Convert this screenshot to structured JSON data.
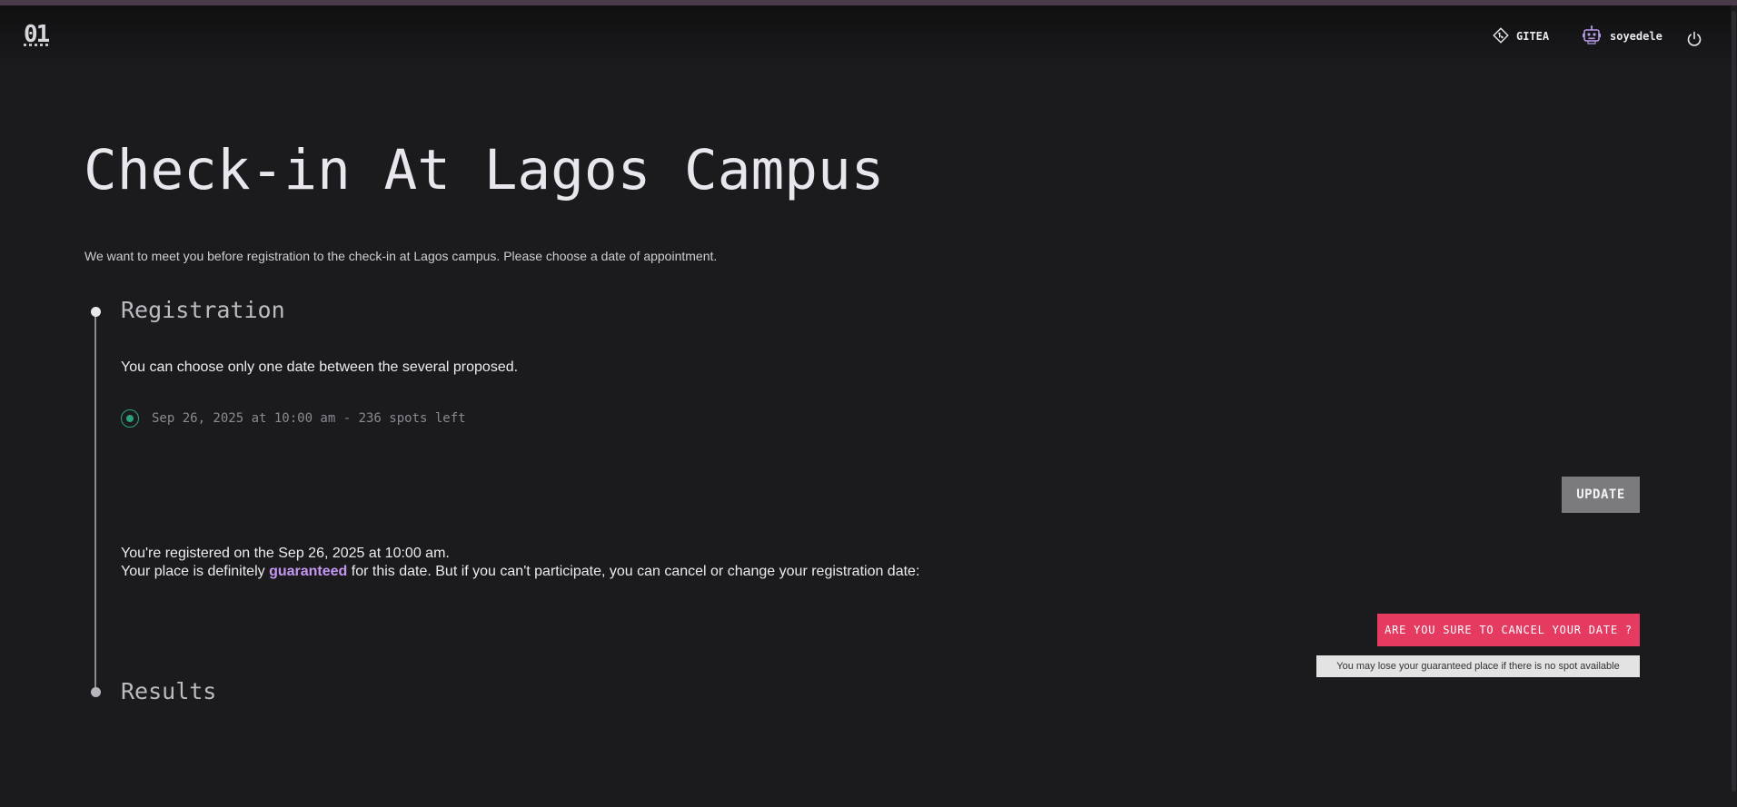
{
  "header": {
    "logo": "01",
    "gitea_label": "GITEA",
    "username": "soyedele",
    "icons": {
      "gitea": "gitea-diamond-icon",
      "user": "robot-avatar-icon",
      "logout": "power-icon"
    }
  },
  "main": {
    "title": "Check-in At Lagos Campus",
    "intro": "We want to meet you before registration to the check-in at Lagos campus. Please choose a date of appointment.",
    "registration": {
      "heading": "Registration",
      "choose_text": "You can choose only one date between the several proposed.",
      "option_label": "Sep 26, 2025 at 10:00 am - 236 spots left",
      "option_selected": true,
      "update_label": "UPDATE",
      "registered_text": "You're registered on the Sep 26, 2025 at 10:00 am.",
      "place_prefix": "Your place is definitely ",
      "place_highlight": "guaranteed",
      "place_suffix": " for this date. But if you can't participate, you can cancel or change your registration date:",
      "cancel_label": "ARE YOU SURE TO CANCEL YOUR DATE ?",
      "tooltip": "You may lose your guaranteed place if there is no spot available"
    },
    "results": {
      "heading": "Results"
    }
  },
  "colors": {
    "background": "#1b1b1e",
    "accent_green": "#2ca17f",
    "danger": "#e63b61",
    "highlight_purple": "#c597f2",
    "update_button": "#7b7b7d"
  }
}
